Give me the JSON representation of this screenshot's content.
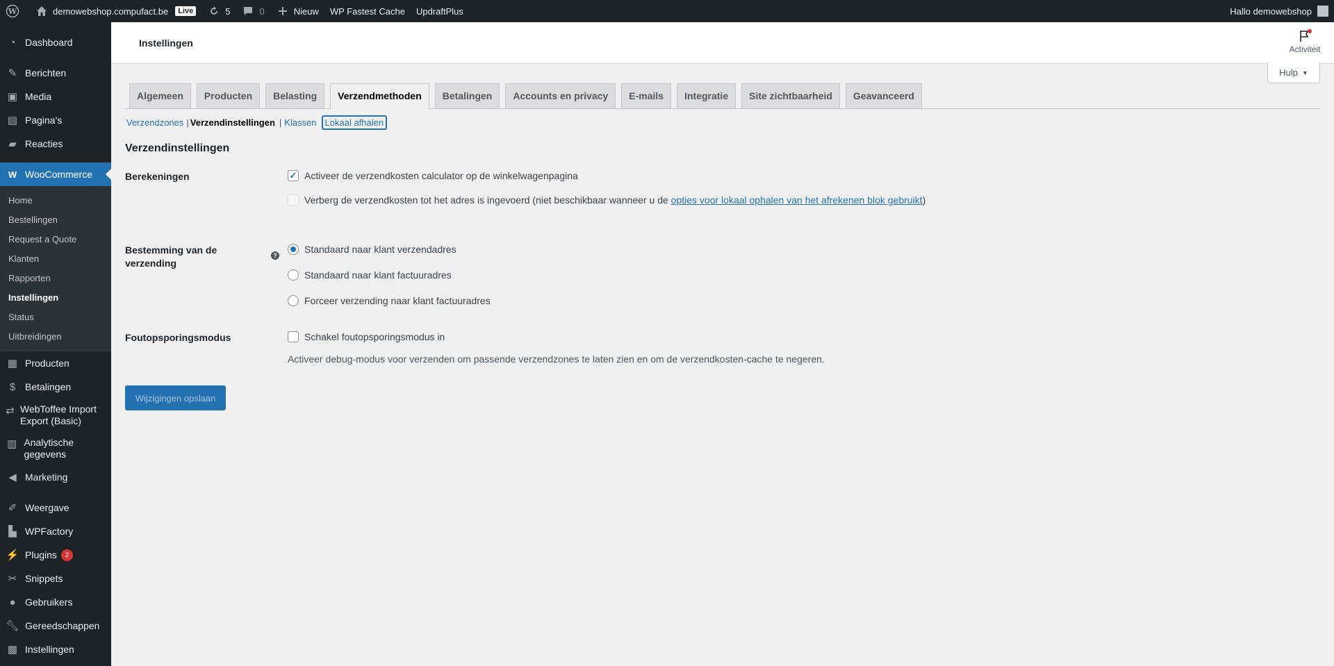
{
  "adminbar": {
    "site_name": "demowebshop.compufact.be",
    "live": "Live",
    "updates": "5",
    "comments": "0",
    "new": "Nieuw",
    "plugin1": "WP Fastest Cache",
    "plugin2": "UpdraftPlus",
    "greeting": "Hallo demowebshop"
  },
  "sidebar": {
    "dashboard": "Dashboard",
    "posts": "Berichten",
    "media": "Media",
    "pages": "Pagina's",
    "comments": "Reacties",
    "woocommerce": "WooCommerce",
    "sub": [
      "Home",
      "Bestellingen",
      "Request a Quote",
      "Klanten",
      "Rapporten",
      "Instellingen",
      "Status",
      "Uitbreidingen"
    ],
    "products": "Producten",
    "payments": "Betalingen",
    "webtoffee": "WebToffee Import Export (Basic)",
    "analytics": "Analytische gegevens",
    "marketing": "Marketing",
    "appearance": "Weergave",
    "wpfactory": "WPFactory",
    "plugins": "Plugins",
    "plugins_badge": "2",
    "snippets": "Snippets",
    "users": "Gebruikers",
    "tools": "Gereedschappen",
    "settings": "Instellingen"
  },
  "header": {
    "title": "Instellingen",
    "activity": "Activiteit",
    "help": "Hulp"
  },
  "tabs": [
    "Algemeen",
    "Producten",
    "Belasting",
    "Verzendmethoden",
    "Betalingen",
    "Accounts en privacy",
    "E-mails",
    "Integratie",
    "Site zichtbaarheid",
    "Geavanceerd"
  ],
  "subnav": {
    "zones": "Verzendzones",
    "settings": "Verzendinstellingen",
    "classes": "Klassen",
    "pickup": "Lokaal afhalen"
  },
  "section_title": "Verzendinstellingen",
  "calculations": {
    "label": "Berekeningen",
    "option1": "Activeer de verzendkosten calculator op de winkelwagenpagina",
    "option1_checked": true,
    "option2_prefix": "Verberg de verzendkosten tot het adres is ingevoerd (niet beschikbaar wanneer u de ",
    "option2_link": "opties voor lokaal ophalen van het afrekenen blok gebruikt",
    "option2_suffix": ")"
  },
  "destination": {
    "label": "Bestemming van de verzending",
    "help": "?",
    "options": [
      "Standaard naar klant verzendadres",
      "Standaard naar klant factuuradres",
      "Forceer verzending naar klant factuuradres"
    ],
    "selected": 0
  },
  "debug": {
    "label": "Foutopsporingsmodus",
    "option": "Schakel foutopsporingsmodus in",
    "description": "Activeer debug-modus voor verzenden om passende verzendzones te laten zien en om de verzendkosten-cache te negeren."
  },
  "save_label": "Wijzigingen opslaan"
}
